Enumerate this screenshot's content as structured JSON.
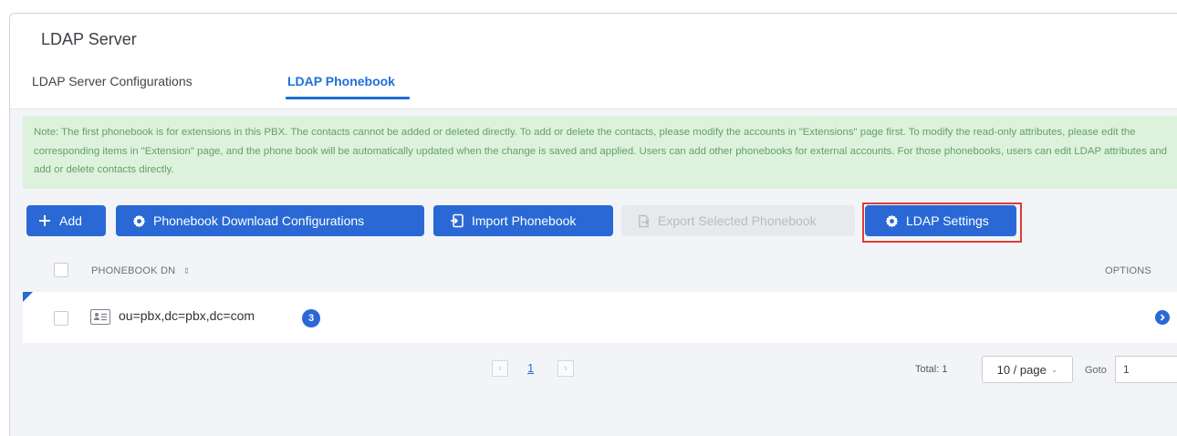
{
  "header": {
    "title": "LDAP Server",
    "tabs": [
      {
        "label": "LDAP Server Configurations",
        "active": false
      },
      {
        "label": "LDAP Phonebook",
        "active": true
      }
    ]
  },
  "note": "Note: The first phonebook is for extensions in this PBX. The contacts cannot be added or deleted directly. To add or delete the contacts, please modify the accounts in \"Extensions\" page first. To modify the read-only attributes, please edit the corresponding items in \"Extension\" page, and the phone book will be automatically updated when the change is saved and applied. Users can add other phonebooks for external accounts. For those phonebooks, users can edit LDAP attributes and add or delete contacts directly.",
  "toolbar": {
    "add": "Add",
    "download_config": "Phonebook Download Configurations",
    "import": "Import Phonebook",
    "export": "Export Selected Phonebook",
    "ldap_settings": "LDAP Settings"
  },
  "table": {
    "columns": {
      "dn": "PHONEBOOK DN",
      "options": "OPTIONS"
    },
    "rows": [
      {
        "dn": "ou=pbx,dc=pbx,dc=com",
        "count": "3"
      }
    ]
  },
  "pagination": {
    "current_page": "1",
    "total": "Total: 1",
    "page_size": "10 / page",
    "goto_label": "Goto",
    "goto_value": "1"
  },
  "colors": {
    "accent": "#2a69d5",
    "note_bg": "#dcf2dd",
    "note_text": "#66a066",
    "highlight": "#e03b3b"
  }
}
